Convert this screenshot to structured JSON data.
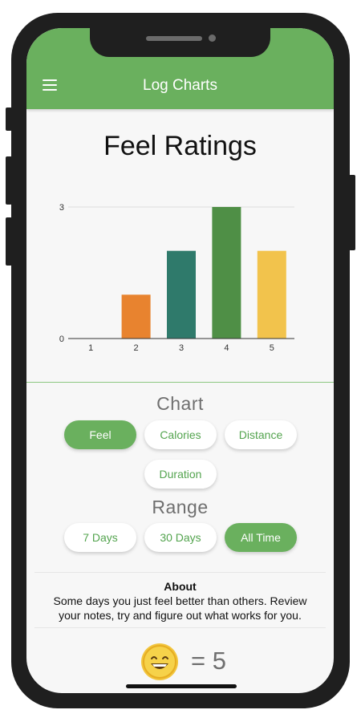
{
  "app": {
    "title": "Log Charts"
  },
  "page": {
    "title": "Feel Ratings"
  },
  "chart_data": {
    "type": "bar",
    "categories": [
      "1",
      "2",
      "3",
      "4",
      "5"
    ],
    "values": [
      0,
      1,
      2,
      3,
      2
    ],
    "colors": [
      "#e8832f",
      "#e8832f",
      "#2f7a6b",
      "#4f8f46",
      "#f2c34c"
    ],
    "ylim": [
      0,
      3
    ],
    "yticks": [
      "0",
      "3"
    ],
    "grid": true,
    "legend": "none"
  },
  "chart_section": {
    "title": "Chart",
    "options": [
      "Feel",
      "Calories",
      "Distance",
      "Duration"
    ],
    "selected": "Feel"
  },
  "range_section": {
    "title": "Range",
    "options": [
      "7 Days",
      "30 Days",
      "All Time"
    ],
    "selected": "All Time"
  },
  "about": {
    "title": "About",
    "text": "Some days you just feel better than others. Review your notes, try and figure out what works for you."
  },
  "score": {
    "text": "= 5",
    "icon": "grinning-face-icon"
  }
}
